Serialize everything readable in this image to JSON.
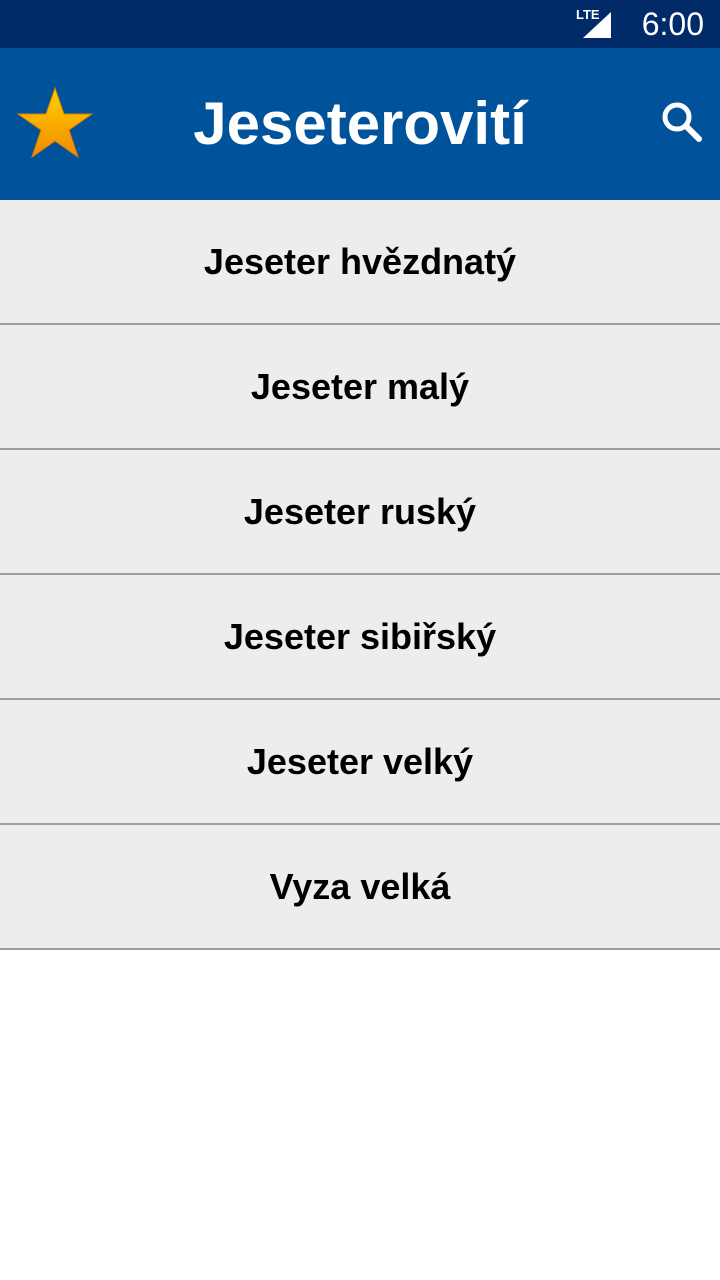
{
  "status_bar": {
    "network": "LTE",
    "time": "6:00",
    "background": "#002a68"
  },
  "app_bar": {
    "title": "Jeseterovití",
    "background": "#00539b",
    "left_icon": "star-icon",
    "right_icon": "search-icon"
  },
  "list": {
    "items": [
      {
        "label": "Jeseter hvězdnatý"
      },
      {
        "label": "Jeseter malý"
      },
      {
        "label": "Jeseter ruský"
      },
      {
        "label": "Jeseter sibiřský"
      },
      {
        "label": "Jeseter velký"
      },
      {
        "label": "Vyza velká"
      }
    ],
    "item_background": "#ededed",
    "divider_color": "#9e9e9e"
  }
}
